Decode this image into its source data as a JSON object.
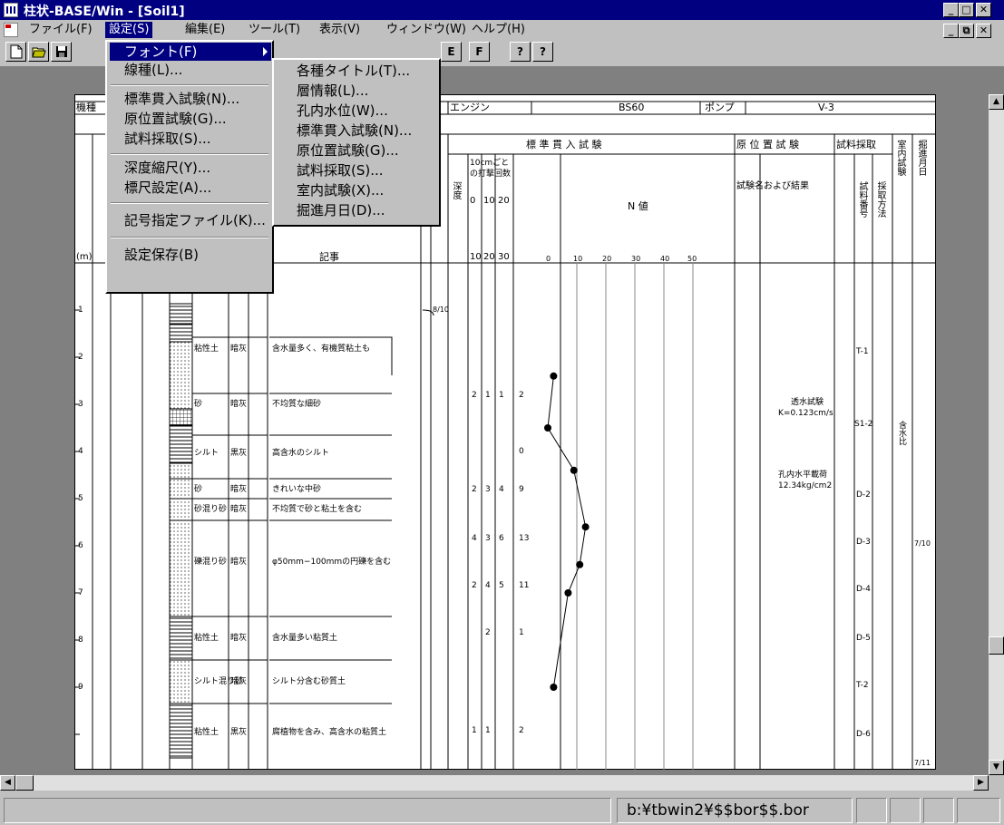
{
  "window": {
    "title": "柱状-BASE/Win - [Soil1]",
    "caption_min": "_",
    "caption_max": "□",
    "caption_close": "✕",
    "doc_restore": "⧉"
  },
  "menubar": {
    "items": [
      "ファイル(F)",
      "設定(S)",
      "編集(E)",
      "ツール(T)",
      "表示(V)",
      "ウィンドウ(W)",
      "ヘルプ(H)"
    ]
  },
  "toolbar": {
    "e_button": "E",
    "f_button": "F",
    "help_glyph": "?",
    "whatsthis_glyph": "?"
  },
  "settings_menu": {
    "items": [
      "フォント(F)",
      "線種(L)...",
      "標準貫入試験(N)...",
      "原位置試験(G)...",
      "試料採取(S)...",
      "深度縮尺(Y)...",
      "標尺設定(A)...",
      "記号指定ファイル(K)...",
      "設定保存(B)"
    ]
  },
  "font_submenu": {
    "items": [
      "各種タイトル(T)...",
      "層情報(L)...",
      "孔内水位(W)...",
      "標準貫入試験(N)...",
      "原位置試験(G)...",
      "試料採取(S)...",
      "室内試験(X)...",
      "掘進月日(D)..."
    ]
  },
  "document": {
    "header_labels": {
      "machine_label": "機種",
      "engine_label": "エンジン",
      "engine_value": "BS60",
      "pump_label": "ポンプ",
      "pump_value": "V-3",
      "spt_title": "標 準 貫 入 試 験",
      "insitu_title": "原 位 置 試 験",
      "sampling_title": "試料採取",
      "lab_title": "室内試験",
      "digging_title": "掘進月日",
      "n_value": "N 値",
      "scale_unit": "(m)",
      "blows_header": "10cmごとの打撃回数",
      "blows_ticks": [
        "0",
        "10",
        "20"
      ],
      "blows_sub": [
        "10",
        "20",
        "30"
      ],
      "n_ticks": [
        "0",
        "10",
        "20",
        "30",
        "40",
        "50"
      ],
      "insitu_sub": "試験名および結果",
      "depth_label": "深度",
      "sample_no": "試料番号",
      "sample_method": "採取方法",
      "dummy_label": "記事"
    },
    "depth_ticks": [
      "1",
      "2",
      "3",
      "4",
      "5",
      "6",
      "7",
      "8",
      "9"
    ],
    "layer_rows": [
      {
        "soil": "粘性土",
        "color": "暗灰",
        "desc": "含水量多く、有機質粘土も"
      },
      {
        "soil": "砂",
        "color": "暗灰",
        "desc": "不均質な細砂"
      },
      {
        "soil": "シルト",
        "color": "黒灰",
        "desc": "高含水のシルト"
      },
      {
        "soil": "砂",
        "color": "暗灰",
        "desc": "きれいな中砂"
      },
      {
        "soil": "砂混り砂",
        "color": "暗灰",
        "desc": "不均質で砂と粘土を含む"
      },
      {
        "soil": "礫混り砂",
        "color": "暗灰",
        "desc": "φ50mm−100mmの円礫を含む"
      },
      {
        "soil": "粘性土",
        "color": "暗灰",
        "desc": "含水量多い粘質土"
      },
      {
        "soil": "シルト混り砂",
        "color": "暗灰",
        "desc": "シルト分含む砂質土"
      },
      {
        "soil": "粘性土",
        "color": "黒灰",
        "desc": "腐植物を含み、高含水の粘質土"
      }
    ],
    "blow_rows": [
      {
        "a": "2",
        "b": "1",
        "c": "1",
        "n": "2"
      },
      {
        "a": "",
        "b": "",
        "c": "",
        "n": "0"
      },
      {
        "a": "2",
        "b": "3",
        "c": "4",
        "n": "9"
      },
      {
        "a": "4",
        "b": "3",
        "c": "6",
        "n": "13"
      },
      {
        "a": "2",
        "b": "4",
        "c": "5",
        "n": "11"
      },
      {
        "a": "",
        "b": "2",
        "c": "",
        "n": "1"
      },
      {
        "a": "1",
        "b": "1",
        "c": "",
        "n": "2"
      }
    ],
    "insitu_notes": [
      "透水試験",
      "K=0.123cm/s",
      "孔内水平載荷",
      "12.34kg/cm2"
    ],
    "sample_ids": [
      "T-1",
      "S1-2",
      "D-2",
      "D-3",
      "D-4",
      "D-5",
      "T-2",
      "D-6"
    ],
    "lab_note": "含水比",
    "dates": [
      "8/10",
      "7/10",
      "7/11"
    ]
  },
  "chart_data": {
    "type": "line",
    "title": "N 値",
    "xlabel": "",
    "ylabel": "",
    "x_ticks": [
      "0",
      "10",
      "20",
      "30",
      "40",
      "50"
    ],
    "series": [
      {
        "x": [
          2,
          0,
          9,
          13,
          11,
          7,
          2
        ],
        "y": [
          2.4,
          3.5,
          4.4,
          5.6,
          6.4,
          7.0,
          9.0
        ]
      }
    ]
  },
  "status": {
    "path": "b:¥tbwin2¥$$bor$$.bor"
  }
}
